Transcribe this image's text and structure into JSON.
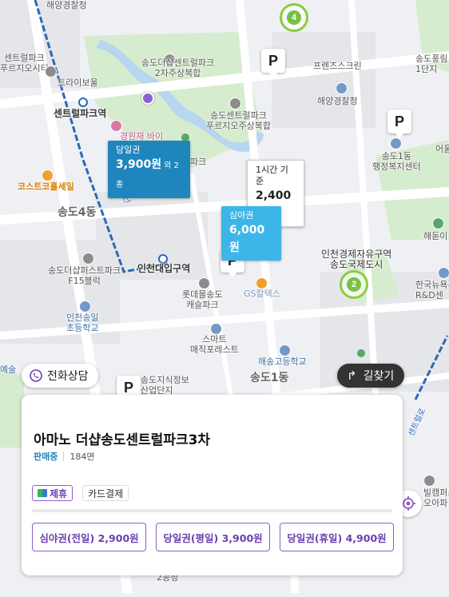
{
  "map": {
    "labels": {
      "coast_guard_top": "해양경찰청",
      "central_park_officetel": "센트럴파크\n푸르지오시티",
      "tri_bowl": "트라이보울",
      "central_park_station": "센트럴파크역",
      "costco": "코스트코홀세일",
      "songdo4": "송도4동",
      "songdo_the_sharp_cp2": "송도더샵센트럴파크\n2차주상복합",
      "gyeongwonjae": "경원재 바이",
      "park_label": "파크",
      "prugio_cp": "송도센트럴파크\n푸르지오주상복합",
      "friends_screen": "프렌즈스크린",
      "coast_guard": "해양경찰청",
      "songdo_poongrim": "송도풍림\n1단지",
      "songdo1_center": "송도1동\n행정복지센터",
      "haedoji": "해돋이",
      "eoul": "어울",
      "incheon_free_zone": "인천경제자유구역\n송도국제도시",
      "korea_polytech": "한국뉴욕주\nR&D센",
      "the_sharp_first_park": "송도더샵퍼스트파크\nF15블럭",
      "incheon_univ_station": "인천대입구역",
      "lotte_mart": "롯데몰송도\n캐슬파크",
      "gs_caltex": "GS칼텍스",
      "incheon_songil_elem": "인천송일\n초등학교",
      "smart_forest": "스마트\n매직포레스트",
      "haesong_high": "해송고등학교",
      "songdo1": "송도1동",
      "songdo_knowledge": "송도지식정보\n산업단지",
      "arts": "예술",
      "road_1": "1호선",
      "road_central": "센트럴로",
      "gangbeol": "2공정",
      "bottom_campus": "빌캠퍼스\n오아파"
    },
    "clusters": [
      {
        "count": "4"
      },
      {
        "count": "2"
      }
    ],
    "parking_icon": "P",
    "price_tags": {
      "day_pass": {
        "label": "당일권",
        "value": "3,900원",
        "extra": "외 2종"
      },
      "hourly": {
        "label": "1시간 기준",
        "value": "2,400원"
      },
      "night": {
        "label": "심야권",
        "value": "6,000원"
      }
    }
  },
  "buttons": {
    "phone_consult": "전화상담",
    "directions": "길찾기"
  },
  "card": {
    "title": "아마노 더샵송도센트럴파크3차",
    "status": "판매중",
    "spaces": "184면",
    "features": [
      "제휴",
      "카드결제"
    ],
    "prices": [
      "심야권(전일) 2,900원",
      "당일권(평일) 3,900원",
      "당일권(휴일) 4,900원"
    ]
  },
  "colors": {
    "accent_purple": "#8e5ec7",
    "day_tag": "#1f86bd",
    "night_tag": "#3cb6e9",
    "cluster_green": "#7ac142"
  }
}
